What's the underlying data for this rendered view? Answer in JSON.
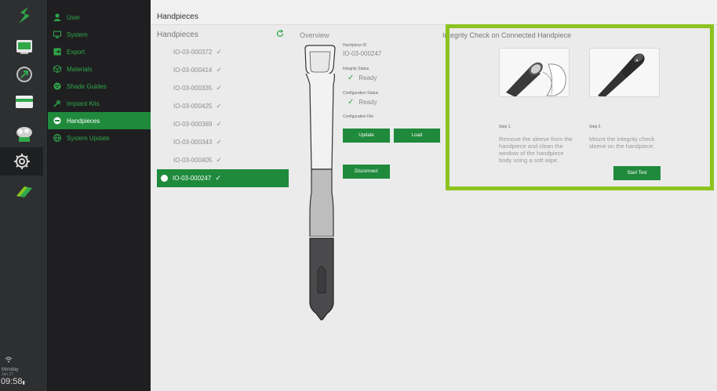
{
  "rail": {
    "day": "Monday",
    "date": "Jan 27",
    "time": "09:58"
  },
  "menu": {
    "items": [
      {
        "label": "User",
        "icon": "user-icon"
      },
      {
        "label": "System",
        "icon": "monitor-icon"
      },
      {
        "label": "Export",
        "icon": "export-icon"
      },
      {
        "label": "Materials",
        "icon": "materials-icon"
      },
      {
        "label": "Shade Guides",
        "icon": "shade-guides-icon"
      },
      {
        "label": "Implant Kits",
        "icon": "implant-kits-icon"
      },
      {
        "label": "Handpieces",
        "icon": "handpiece-icon",
        "active": true
      },
      {
        "label": "System Update",
        "icon": "globe-icon"
      }
    ]
  },
  "header": {
    "title": "Handpieces"
  },
  "handpieces": {
    "title": "Handpieces",
    "items": [
      "IO-03-000372",
      "IO-03-000414",
      "IO-03-000335",
      "IO-03-000425",
      "IO-03-000369",
      "IO-03-000343",
      "IO-03-000405",
      "IO-03-000247"
    ],
    "active_index": 7
  },
  "overview": {
    "title": "Overview",
    "id_label": "Handpiece ID",
    "id_value": "IO-03-000247",
    "integrity_label": "Integrity Status",
    "integrity_value": "Ready",
    "config_label": "Configuration Status",
    "config_value": "Ready",
    "file_label": "Configuration File",
    "update_label": "Update",
    "load_label": "Load",
    "disconnect_label": "Disconnect"
  },
  "integrity": {
    "title": "Integrity Check on Connected Handpiece",
    "step1_label": "Step 1.",
    "step1_text": "Remove the sleeve from the handpiece and clean the window of the handpiece body using a soft wipe.",
    "step2_label": "Step 2.",
    "step2_text": "Mount the integrity check sleeve on the handpiece.",
    "start_label": "Start Test"
  },
  "colors": {
    "accent": "#1f8a3c",
    "menu_text": "#2fa84a",
    "highlight": "#8cc31f"
  }
}
